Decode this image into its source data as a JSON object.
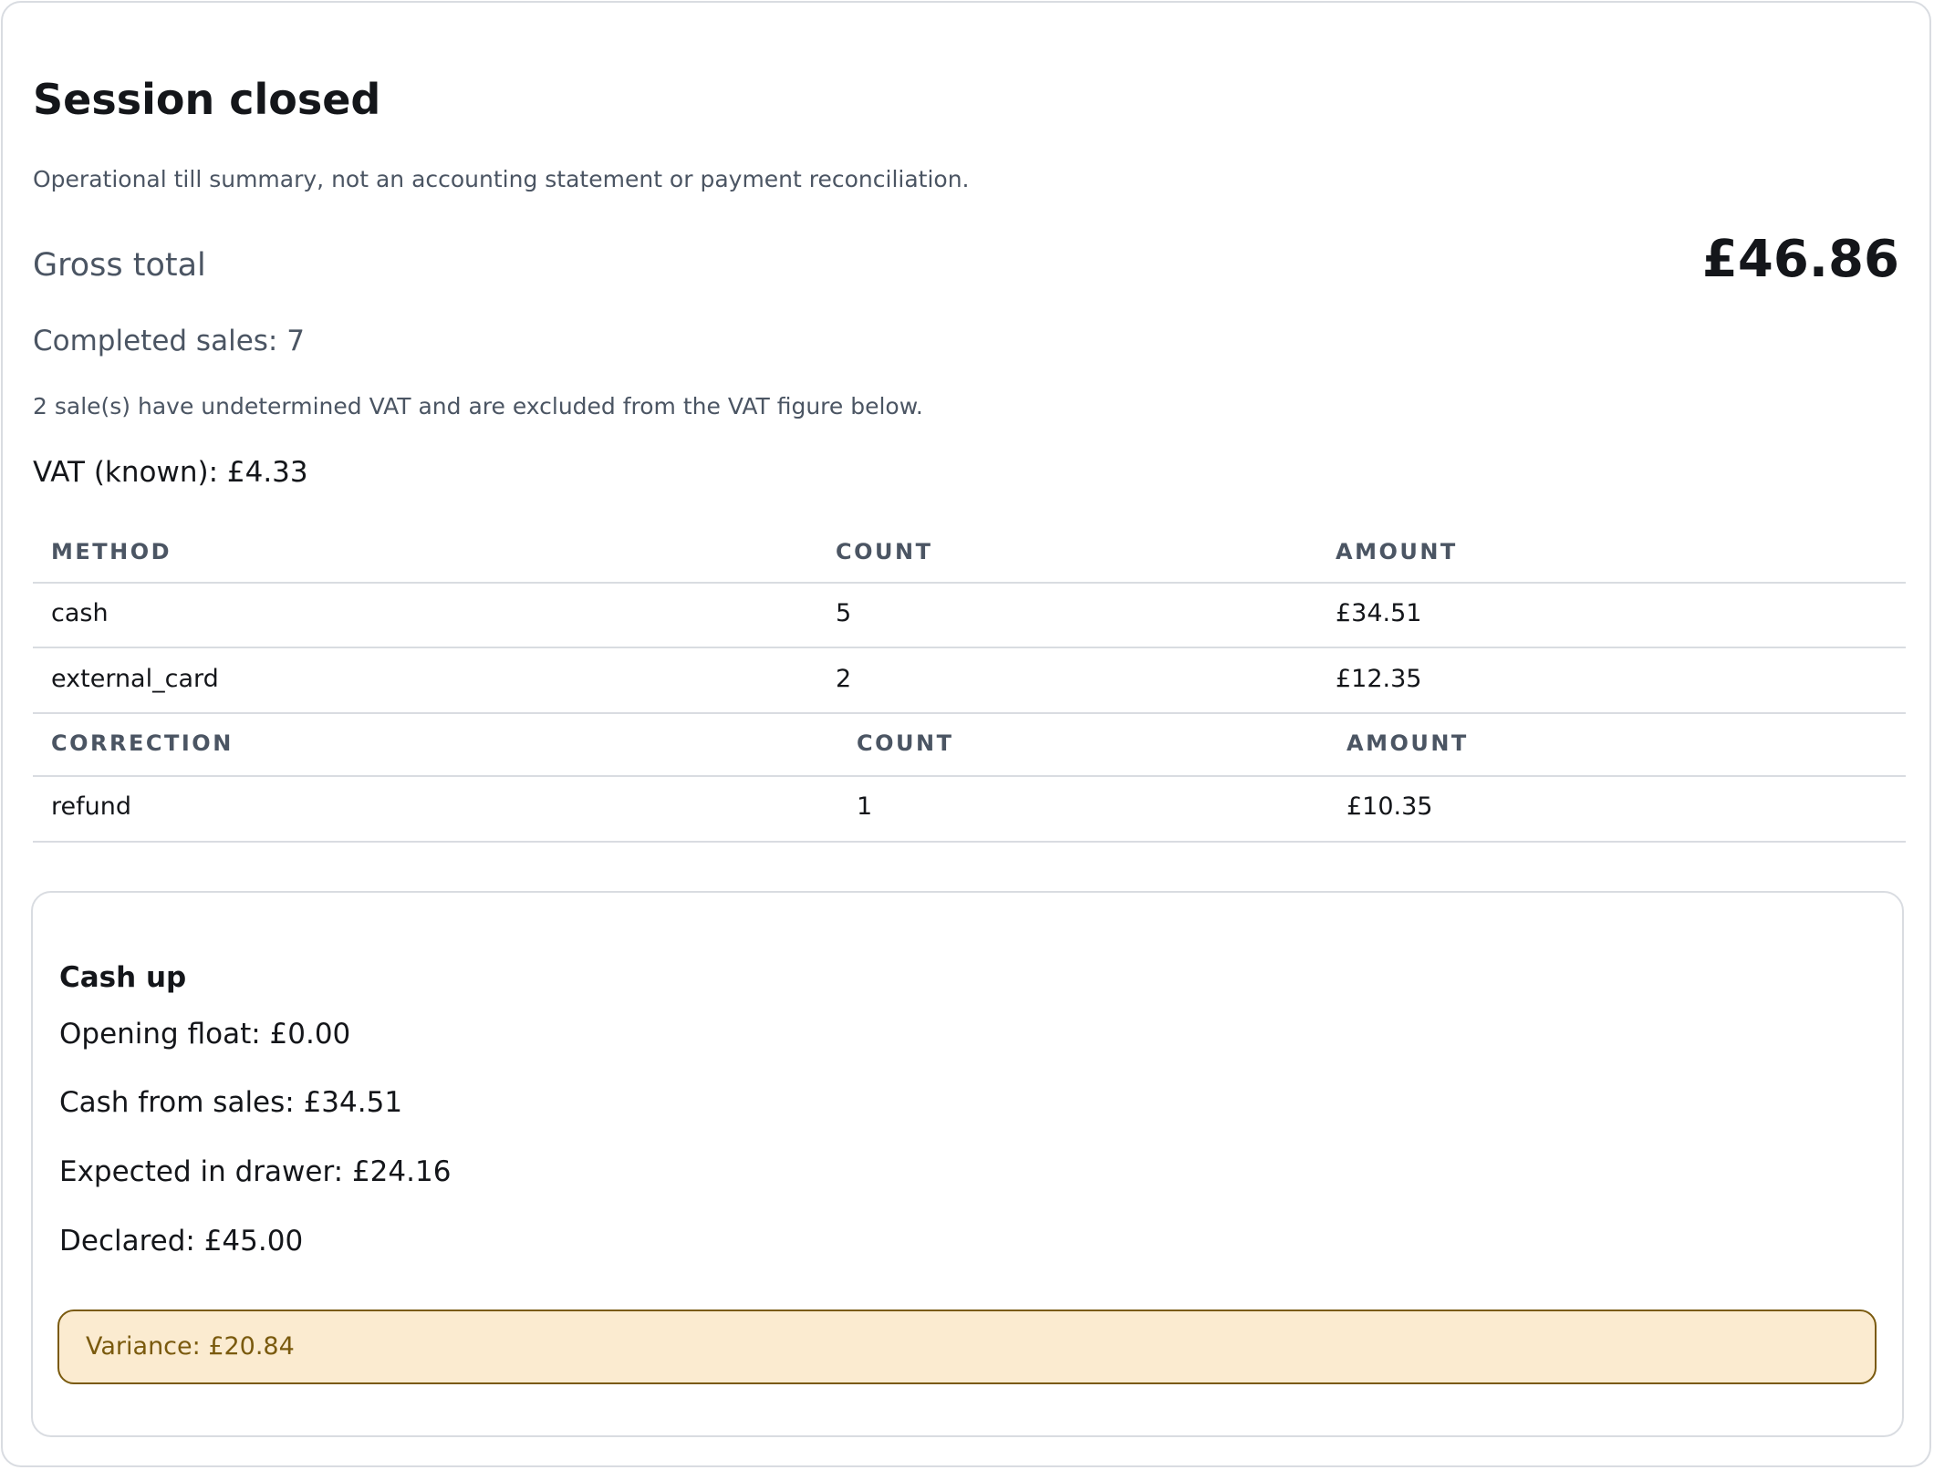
{
  "title": "Session closed",
  "disclaimer": "Operational till summary, not an accounting statement or payment reconciliation.",
  "gross": {
    "label": "Gross total",
    "value": "£46.86"
  },
  "completed_sales": "Completed sales: 7",
  "vat_note": "2 sale(s) have undetermined VAT and are excluded from the VAT figure below.",
  "vat_known": "VAT (known): £4.33",
  "methods": {
    "headers": [
      "METHOD",
      "COUNT",
      "AMOUNT"
    ],
    "rows": [
      [
        "cash",
        "5",
        "£34.51"
      ],
      [
        "external_card",
        "2",
        "£12.35"
      ]
    ]
  },
  "corrections": {
    "headers": [
      "CORRECTION",
      "COUNT",
      "AMOUNT"
    ],
    "rows": [
      [
        "refund",
        "1",
        "£10.35"
      ]
    ]
  },
  "cashup": {
    "title": "Cash up",
    "lines": [
      "Opening float: £0.00",
      "Cash from sales: £34.51",
      "Expected in drawer: £24.16",
      "Declared: £45.00"
    ],
    "variance": "Variance: £20.84"
  },
  "colors": {
    "text": "#14161a",
    "muted": "#4b5563",
    "border": "#d9dce1",
    "warning_bg": "#fbebd0",
    "warning_border": "#7a5a0e"
  }
}
